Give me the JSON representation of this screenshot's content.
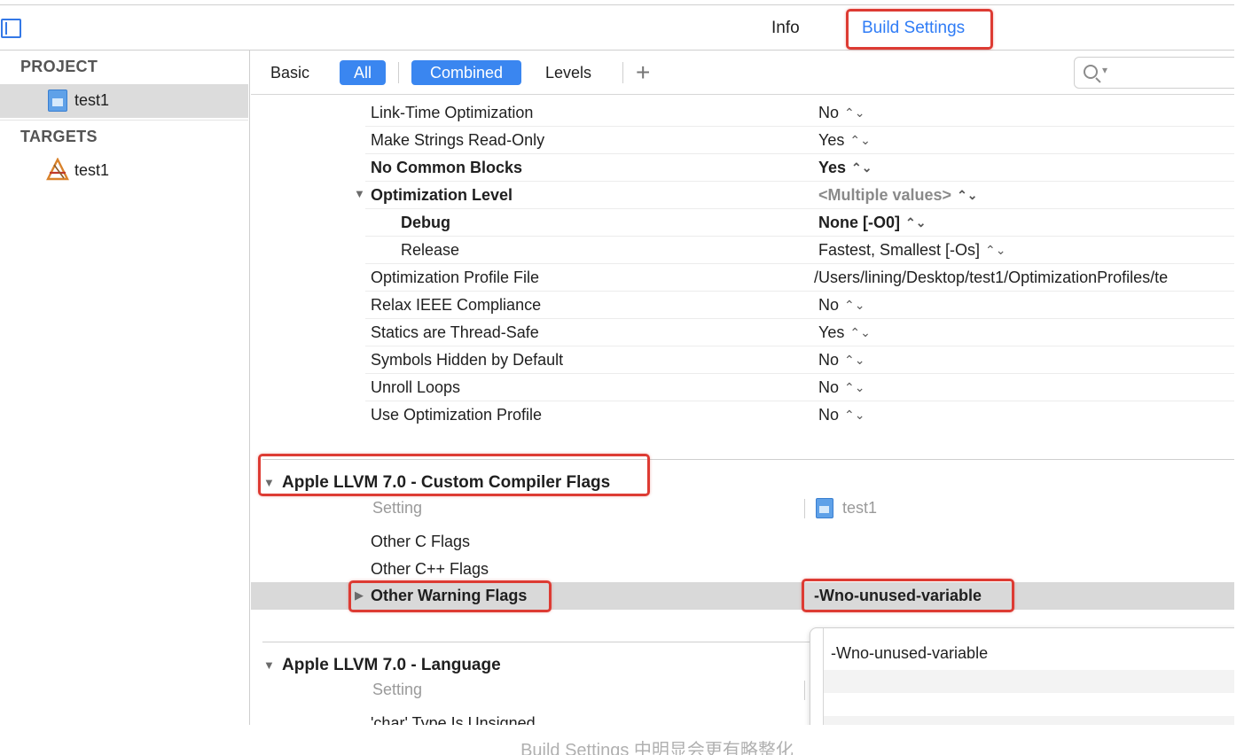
{
  "window": {
    "tabs": {
      "info": "Info",
      "build_settings": "Build Settings"
    }
  },
  "sidebar": {
    "project_header": "PROJECT",
    "project_item": "test1",
    "targets_header": "TARGETS",
    "target_item": "test1"
  },
  "filter_bar": {
    "basic": "Basic",
    "all": "All",
    "combined": "Combined",
    "levels": "Levels",
    "add": "+"
  },
  "settings": [
    {
      "name": "Link-Time Optimization",
      "value": "No",
      "bold": false
    },
    {
      "name": "Make Strings Read-Only",
      "value": "Yes",
      "bold": false
    },
    {
      "name": "No Common Blocks",
      "value": "Yes",
      "bold": true
    },
    {
      "name": "Optimization Level",
      "value": "<Multiple values>",
      "bold": true,
      "expanded": true
    },
    {
      "name": "Debug",
      "value": "None [-O0]",
      "bold": true,
      "child": true
    },
    {
      "name": "Release",
      "value": "Fastest, Smallest [-Os]",
      "bold": false,
      "child": true
    },
    {
      "name": "Optimization Profile File",
      "value": "/Users/lining/Desktop/test1/OptimizationProfiles/te",
      "bold": false
    },
    {
      "name": "Relax IEEE Compliance",
      "value": "No",
      "bold": false
    },
    {
      "name": "Statics are Thread-Safe",
      "value": "Yes",
      "bold": false
    },
    {
      "name": "Symbols Hidden by Default",
      "value": "No",
      "bold": false
    },
    {
      "name": "Unroll Loops",
      "value": "No",
      "bold": false
    },
    {
      "name": "Use Optimization Profile",
      "value": "No",
      "bold": false
    }
  ],
  "custom_flags_section": {
    "title": "Apple LLVM 7.0 - Custom Compiler Flags",
    "column_setting": "Setting",
    "column_target": "test1",
    "rows": {
      "other_c_flags": "Other C Flags",
      "other_cpp_flags": "Other C++ Flags",
      "other_warning_flags": "Other Warning Flags",
      "other_warning_flags_value": "-Wno-unused-variable"
    }
  },
  "language_section": {
    "title": "Apple LLVM 7.0 - Language",
    "column_setting": "Setting",
    "first_row": "'char' Type Is Unsigned"
  },
  "popover": {
    "entry": "-Wno-unused-variable"
  },
  "caption": "Build Settings 中明显会更有略整化",
  "colors": {
    "accent": "#3a86f0",
    "highlight": "#dd3b33",
    "selected_row": "#d9d9d9"
  }
}
